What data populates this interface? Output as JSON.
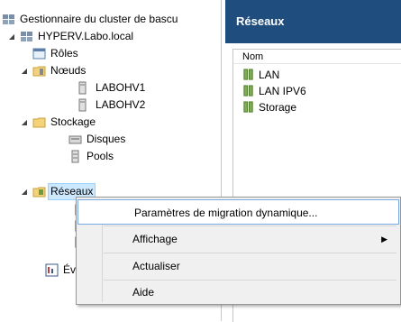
{
  "tree": {
    "root_label": "Gestionnaire du cluster de bascu",
    "cluster_label": "HYPERV.Labo.local",
    "roles_label": "Rôles",
    "nodes_label": "Nœuds",
    "node1_label": "LABOHV1",
    "node2_label": "LABOHV2",
    "storage_label": "Stockage",
    "disks_label": "Disques",
    "pools_label": "Pools",
    "networks_label": "Réseaux",
    "events_label": "Évé"
  },
  "main": {
    "title": "Réseaux",
    "column_name": "Nom",
    "items": [
      "LAN",
      "LAN IPV6",
      "Storage"
    ]
  },
  "context_menu": {
    "items": [
      {
        "label": "Paramètres de migration dynamique..."
      },
      {
        "label": "Affichage"
      },
      {
        "label": "Actualiser"
      },
      {
        "label": "Aide"
      }
    ]
  },
  "colors": {
    "header_bg": "#1f4d7d",
    "selection_bg": "#cce8ff",
    "menu_bg": "#f0f0f0"
  }
}
